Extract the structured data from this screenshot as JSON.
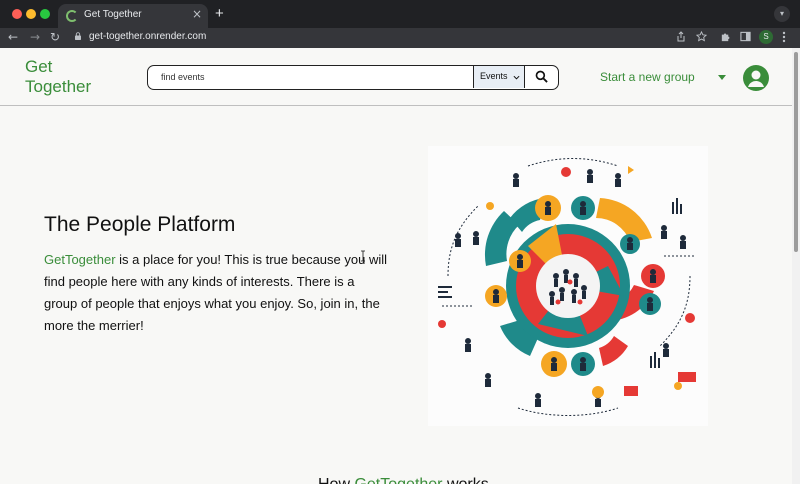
{
  "browser": {
    "tab_title": "Get Together",
    "tab_close": "×",
    "new_tab": "+",
    "url": "get-together.onrender.com",
    "profile_initial": "S",
    "nav": {
      "back": "←",
      "forward": "→",
      "reload": "↻"
    }
  },
  "header": {
    "logo": "Get Together",
    "search_placeholder": "find events",
    "search_select": "Events",
    "start_group": "Start a new group"
  },
  "hero": {
    "title": "The People Platform",
    "brand": "GetTogether",
    "text": " is a place for you! This is true because you will find people here with any kinds of interests. There is a group of people that enjoys what you enjoy. So, join in, the more the merrier!"
  },
  "bottom": {
    "heading_prefix": "How ",
    "heading_brand": "GetTogether",
    "heading_suffix": " works"
  },
  "colors": {
    "brand_green": "#3a8d3a",
    "art_red": "#e53935",
    "art_teal": "#1f8a8a",
    "art_orange": "#f5a623",
    "art_navy": "#1e2a3a"
  },
  "icons": [
    "search-icon",
    "chevron-down-icon",
    "user-avatar-icon",
    "lock-icon",
    "share-icon",
    "star-icon",
    "puzzle-icon",
    "sidebar-icon",
    "more-vert-icon"
  ]
}
